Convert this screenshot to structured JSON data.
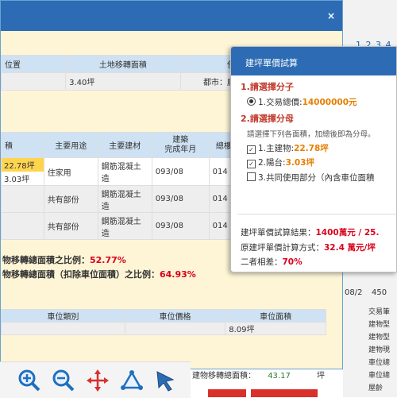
{
  "dialog": {
    "close_label": "×",
    "land_table": {
      "headers": [
        "位置",
        "土地移轉面積",
        "使"
      ],
      "row": [
        "",
        "3.40坪",
        "都市：廁"
      ]
    },
    "building_table": {
      "headers": [
        "積",
        "主要用途",
        "主要建材",
        "建築\n完成年月",
        "總樓"
      ],
      "rows": [
        {
          "area1": "22.78坪",
          "area2": "3.03坪",
          "use": "住家用",
          "material": "鋼筋混凝土造",
          "year": "093/08",
          "floor": "014"
        },
        {
          "area1": "",
          "area2": "",
          "use": "共有部份",
          "material": "鋼筋混凝土造",
          "year": "093/08",
          "floor": "014"
        },
        {
          "area1": "",
          "area2": "",
          "use": "共有部份",
          "material": "鋼筋混凝土造",
          "year": "093/08",
          "floor": "014"
        }
      ]
    },
    "ratio1_label": "物移轉總面積之比例：",
    "ratio1_value": "52.77%",
    "ratio2_label": "物移轉總面積（扣除車位面積）之比例：",
    "ratio2_value": "64.93%",
    "parking_table": {
      "headers": [
        "車位類別",
        "車位價格",
        "車位面積"
      ],
      "row": [
        "",
        "",
        "8.09坪"
      ]
    }
  },
  "popup": {
    "title": "建坪單價試算",
    "step1": "1.請選擇分子",
    "option_total_label": "1.交易總價:",
    "option_total_value": "14000000元",
    "step2": "2.請選擇分母",
    "hint": "請選擇下列各面積，加總後即為分母。",
    "opt_main_label": "1.主建物:",
    "opt_main_value": "22.78坪",
    "opt_balcony_label": "2.陽台:",
    "opt_balcony_value": "3.03坪",
    "opt_common_label": "3.共同使用部分（內含車位面積",
    "result_label": "建坪單價試算結果：",
    "result_value": "1400萬元 / 25.",
    "orig_label": "原建坪單價計算方式：",
    "orig_value": "32.4 萬元/坪",
    "diff_label": "二者相差：",
    "diff_value": "70%"
  },
  "right_panel": {
    "pager": "1 2 3 4",
    "value_1": "08/2",
    "value_2": "450",
    "labels": [
      "交易筆",
      "建物型",
      "建物型",
      "建物現",
      "車位總",
      "車位總",
      "屋齡"
    ]
  },
  "bottom": {
    "label": "建物移轉總面積：",
    "value": "43.17",
    "unit": "坪"
  }
}
